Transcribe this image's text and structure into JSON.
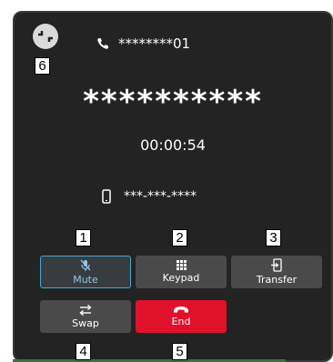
{
  "call": {
    "caller_id": "********01",
    "contact_name": "**********",
    "duration": "00:00:54",
    "phone_number": "***-***-****"
  },
  "buttons": {
    "mute": "Mute",
    "keypad": "Keypad",
    "transfer": "Transfer",
    "swap": "Swap",
    "end": "End"
  },
  "callouts": [
    "1",
    "2",
    "3",
    "4",
    "5",
    "6"
  ],
  "colors": {
    "background": "#232323",
    "button": "#4a4a4a",
    "mute_active_border": "#4aa7c9",
    "end_call": "#e0112b"
  },
  "icons": {
    "minimize": "minimize-icon",
    "caller": "phone-handset-icon",
    "number": "mobile-phone-icon",
    "mute": "microphone-off-icon",
    "keypad": "keypad-grid-icon",
    "transfer": "transfer-icon",
    "swap": "swap-arrows-icon",
    "end": "hang-up-icon"
  }
}
